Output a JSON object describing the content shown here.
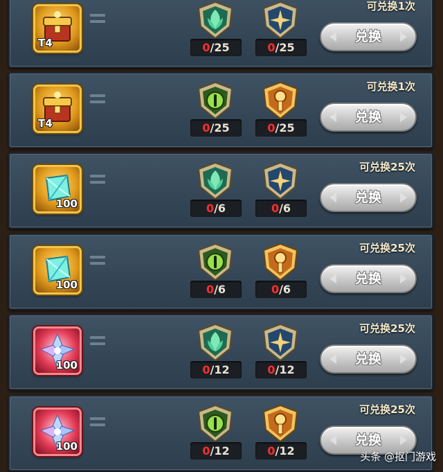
{
  "rows": [
    {
      "item": "chest",
      "badge": "T4",
      "emblems": [
        "leaf",
        "star"
      ],
      "counts": [
        {
          "have": "0",
          "need": "/25"
        },
        {
          "have": "0",
          "need": "/25"
        }
      ],
      "limit": "可兑换1次",
      "button": "兑换"
    },
    {
      "item": "chest",
      "badge": "T4",
      "emblems": [
        "eye",
        "key"
      ],
      "counts": [
        {
          "have": "0",
          "need": "/25"
        },
        {
          "have": "0",
          "need": "/25"
        }
      ],
      "limit": "可兑换1次",
      "button": "兑换"
    },
    {
      "item": "crystal",
      "badge": "100",
      "emblems": [
        "leaf",
        "star"
      ],
      "counts": [
        {
          "have": "0",
          "need": "/6"
        },
        {
          "have": "0",
          "need": "/6"
        }
      ],
      "limit": "可兑换25次",
      "button": "兑换"
    },
    {
      "item": "crystal",
      "badge": "100",
      "emblems": [
        "eye",
        "key"
      ],
      "counts": [
        {
          "have": "0",
          "need": "/6"
        },
        {
          "have": "0",
          "need": "/6"
        }
      ],
      "limit": "可兑换25次",
      "button": "兑换"
    },
    {
      "item": "shard",
      "badge": "100",
      "emblems": [
        "leaf",
        "star"
      ],
      "counts": [
        {
          "have": "0",
          "need": "/12"
        },
        {
          "have": "0",
          "need": "/12"
        }
      ],
      "limit": "可兑换25次",
      "button": "兑换"
    },
    {
      "item": "shard",
      "badge": "100",
      "emblems": [
        "eye",
        "key"
      ],
      "counts": [
        {
          "have": "0",
          "need": "/12"
        },
        {
          "have": "0",
          "need": "/12"
        }
      ],
      "limit": "可兑换25次",
      "button": "兑换"
    }
  ],
  "watermark": "头条 @抠门游戏"
}
